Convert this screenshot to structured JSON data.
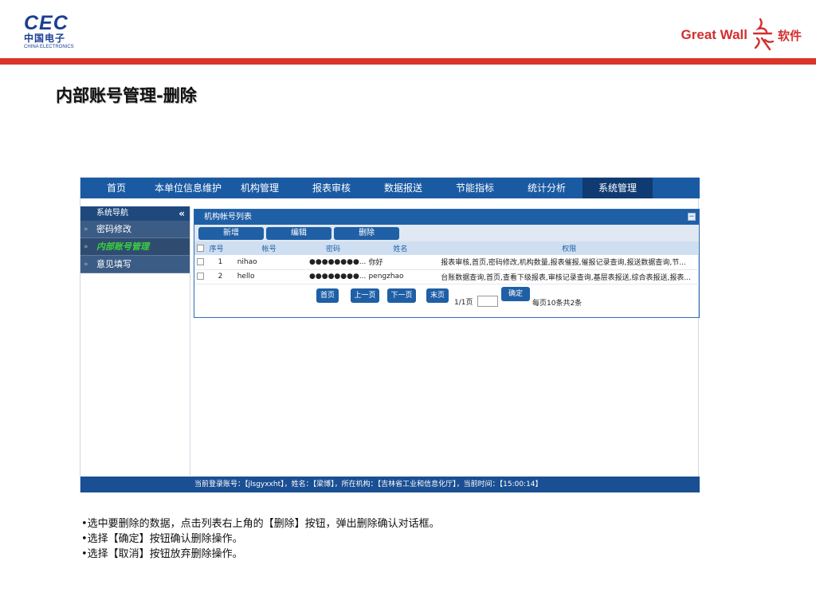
{
  "header": {
    "cec_logo": {
      "big": "CEC",
      "cn": "中国电子",
      "en": "CHINA ELECTRONICS"
    },
    "greatwall_logo": {
      "text": "Great Wall",
      "soft": "软件"
    },
    "accent_color": "#d9352b"
  },
  "slide_title": "内部账号管理-删除",
  "app": {
    "nav": [
      {
        "label": "首页",
        "active": false
      },
      {
        "label": "本单位信息维护",
        "active": false
      },
      {
        "label": "机构管理",
        "active": false
      },
      {
        "label": "报表审核",
        "active": false
      },
      {
        "label": "数据报送",
        "active": false
      },
      {
        "label": "节能指标",
        "active": false
      },
      {
        "label": "统计分析",
        "active": false
      },
      {
        "label": "系统管理",
        "active": true
      }
    ],
    "sidebar": {
      "header": "系统导航",
      "collapse_glyph": "«",
      "items": [
        {
          "label": "密码修改",
          "active": false
        },
        {
          "label": "内部账号管理",
          "active": true
        },
        {
          "label": "意见填写",
          "active": false
        }
      ]
    },
    "panel": {
      "title": "机构帐号列表",
      "collapse_glyph": "−",
      "toolbar": {
        "add": "新增",
        "edit": "编辑",
        "delete": "删除"
      },
      "columns": [
        "序号",
        "帐号",
        "密码",
        "姓名",
        "权限"
      ],
      "rows": [
        {
          "no": "1",
          "account": "nihao",
          "password": "●●●●●●●●...",
          "name": "你好",
          "perm": "报表审核,首页,密码修改,机构数量,报表催报,催报记录查询,报送数据查询,节..."
        },
        {
          "no": "2",
          "account": "hello",
          "password": "●●●●●●●●...",
          "name": "pengzhao",
          "perm": "台账数据查询,首页,查看下级报表,审核记录查询,基层表报送,综合表报送,报表..."
        }
      ],
      "pager": {
        "first": "首页",
        "prev": "上一页",
        "next": "下一页",
        "last": "末页",
        "page_info": "1/1页",
        "confirm": "确定",
        "summary": "每页10条共2条"
      }
    },
    "status_bar": "当前登录账号：【jlsgyxxht】，姓名：【梁博】，所在机构：【吉林省工业和信息化厅】，当前时间：【15:00:14】"
  },
  "instructions": [
    "•选中要删除的数据，点击列表右上角的【删除】按钮，弹出删除确认对话框。",
    "•选择【确定】按钮确认删除操作。",
    "•选择【取消】按钮放弃删除操作。"
  ]
}
